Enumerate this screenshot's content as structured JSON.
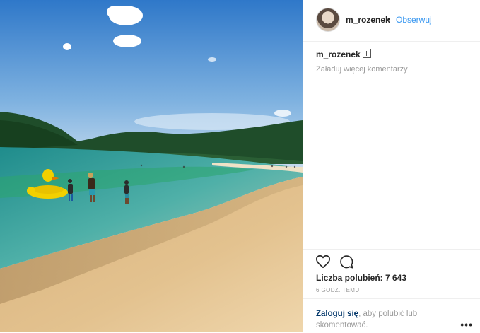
{
  "post": {
    "username": "m_rozenek",
    "separator": "•",
    "follow_label": "Obserwuj",
    "caption_user": "m_rozenek",
    "caption_icon": "box-glyph-icon",
    "load_more_label": "Załaduj więcej komentarzy",
    "likes_text": "Liczba polubień: 7 643",
    "time_text": "6 GODZ. TEMU",
    "login_link": "Zaloguj się",
    "login_rest": ", aby polubić lub skomentować.",
    "more_label": "•••"
  },
  "colors": {
    "link_blue": "#3897f0",
    "text_dark": "#262626",
    "text_grey": "#999999",
    "login_blue": "#003569"
  }
}
